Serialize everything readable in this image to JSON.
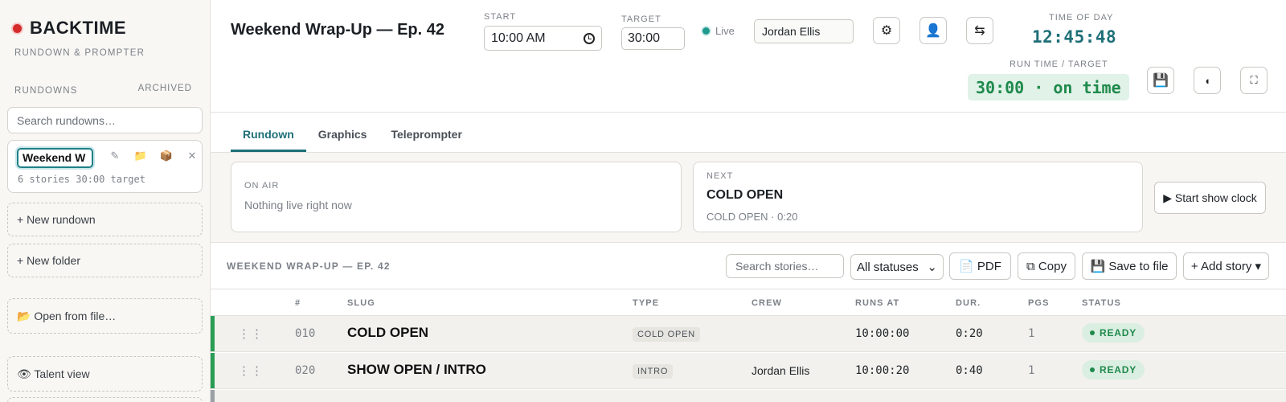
{
  "sidebar": {
    "brand": "BACKTIME",
    "subtitle": "RUNDOWN & PROMPTER",
    "section_label": "RUNDOWNS",
    "archived_label": "ARCHIVED",
    "search_placeholder": "Search rundowns…",
    "active_rundown": {
      "name": "Weekend W",
      "meta": "6 stories 30:00 target",
      "actions": [
        "✎",
        "📁",
        "📦",
        "✕"
      ]
    },
    "buttons": {
      "new_rundown": "+ New rundown",
      "new_folder": "+ New folder",
      "open_file": "📂 Open from file…",
      "talent_view": "👁 Talent view"
    }
  },
  "header": {
    "title": "Weekend Wrap-Up — Ep. 42",
    "start_label": "START",
    "start_value": "10:00 AM",
    "target_label": "TARGET",
    "target_value": "30:00",
    "live_label": "Live",
    "user_name": "Jordan Ellis",
    "icons": {
      "settings": "⚙",
      "user": "👤",
      "swap": "⇆",
      "save": "💾",
      "theme": "◖",
      "fullscreen": "⛶"
    },
    "time_of_day_label": "TIME OF DAY",
    "time_of_day": "12:45:48",
    "run_time_label": "RUN TIME / TARGET",
    "run_time": "30:00 · on time"
  },
  "tabs": [
    "Rundown",
    "Graphics",
    "Teleprompter"
  ],
  "active_tab": "Rundown",
  "on_air": {
    "label": "ON AIR",
    "text": "Nothing live right now"
  },
  "next": {
    "label": "NEXT",
    "slug": "COLD OPEN",
    "meta": "COLD OPEN · 0:20"
  },
  "start_show_clock": "▶ Start show clock",
  "toolbar": {
    "rundown_title": "WEEKEND WRAP-UP — EP. 42",
    "search_placeholder": "Search stories…",
    "status_filter": "All statuses",
    "pdf": "📄 PDF",
    "copy": "⧉ Copy",
    "save": "💾 Save to file",
    "add_story": "+ Add story ▾"
  },
  "table": {
    "columns": [
      "#",
      "SLUG",
      "TYPE",
      "CREW",
      "RUNS AT",
      "DUR.",
      "PGS",
      "STATUS"
    ],
    "rows": [
      {
        "grip": "⋮⋮",
        "num": "010",
        "slug": "COLD OPEN",
        "type": "COLD OPEN",
        "crew": "",
        "runs_at": "10:00:00",
        "dur": "0:20",
        "pgs": "1",
        "status": "READY"
      },
      {
        "grip": "⋮⋮",
        "num": "020",
        "slug": "SHOW OPEN / INTRO",
        "type": "INTRO",
        "crew": "Jordan Ellis",
        "runs_at": "10:00:20",
        "dur": "0:40",
        "pgs": "1",
        "status": "READY"
      }
    ]
  },
  "colors": {
    "accent": "#1f6f78",
    "ready": "#1f8a4c",
    "brand_dot": "#d62b2b"
  }
}
